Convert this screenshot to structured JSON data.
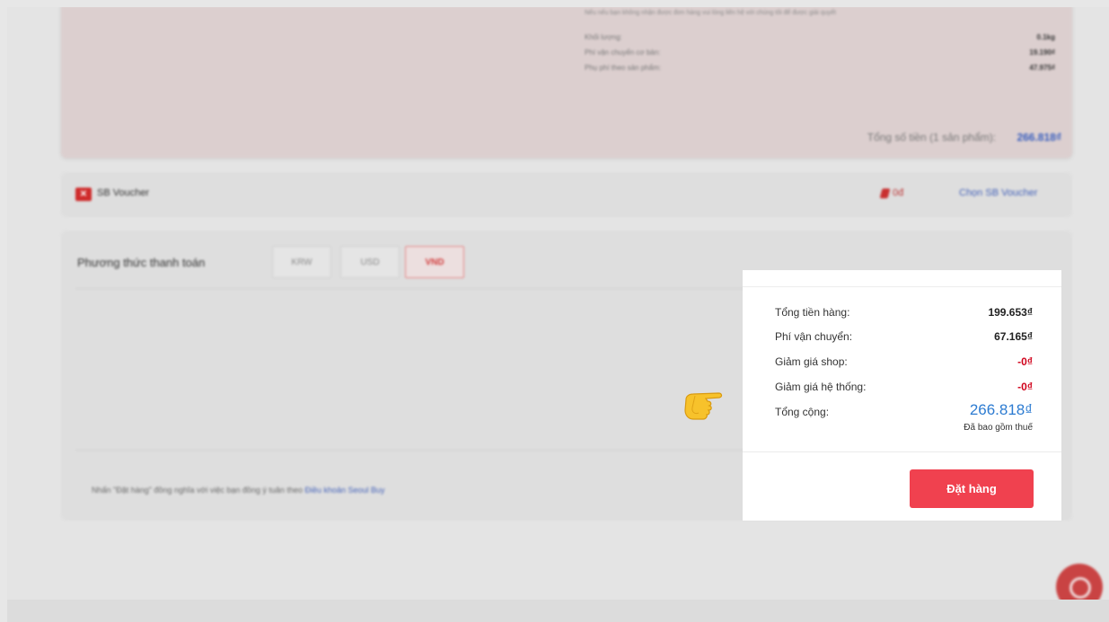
{
  "order": {
    "notice": "Nếu nếu bạn không nhận được đơn hàng vui lòng liên hệ với chúng tôi để được giải quyết",
    "rows": [
      {
        "label": "Khối lượng:",
        "value": "0.1kg"
      },
      {
        "label": "Phí vận chuyển cơ bản:",
        "value": "19.190₫"
      },
      {
        "label": "Phụ phí theo sản phẩm:",
        "value": "47.975₫"
      }
    ],
    "total_label": "Tổng số tiền (1 sản phẩm):",
    "total_value": "266.818₫"
  },
  "voucher": {
    "logo": "✕",
    "title": "SB Voucher",
    "amount": "0đ",
    "choose_label": "Chọn SB Voucher"
  },
  "payment": {
    "title": "Phương thức thanh toán",
    "currencies": [
      "KRW",
      "USD",
      "VND"
    ],
    "selected": "VND",
    "terms_prefix": "Nhấn \"Đặt hàng\" đồng nghĩa với việc bạn đồng ý tuân theo",
    "terms_link": "Điều khoản Seoul Buy"
  },
  "summary": {
    "goods_label": "Tổng tiền hàng:",
    "goods_value": "199.653₫",
    "shipping_label": "Phí vận chuyển:",
    "shipping_value": "67.165₫",
    "shop_discount_label": "Giảm giá shop:",
    "shop_discount_value": "-0₫",
    "system_discount_label": "Giảm giá hệ thống:",
    "system_discount_value": "-0₫",
    "grand_label": "Tổng cộng:",
    "grand_value": "266.818₫",
    "tax_note": "Đã bao gồm thuế",
    "order_button": "Đặt hàng"
  },
  "icons": {
    "pointer": "pointing-hand-icon",
    "chat": "chat-icon"
  },
  "colors": {
    "accent_red": "#f0414f",
    "link_blue": "#2c7bd1"
  }
}
